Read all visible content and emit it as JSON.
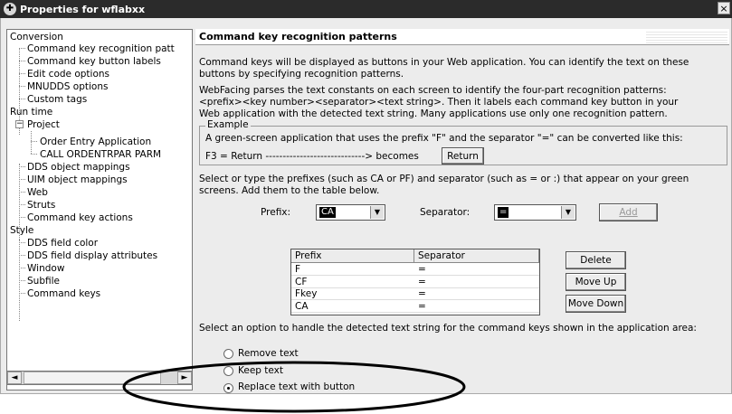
{
  "window": {
    "title": "Properties for wflabxx",
    "close": "×"
  },
  "tree": {
    "items": [
      {
        "label": "Conversion"
      },
      {
        "label": "Command key recognition patt"
      },
      {
        "label": "Command key button labels"
      },
      {
        "label": "Edit code options"
      },
      {
        "label": "MNUDDS options"
      },
      {
        "label": "Custom tags"
      },
      {
        "label": "Run time"
      },
      {
        "label": "Project"
      },
      {
        "label": "Order Entry Application"
      },
      {
        "label": "CALL ORDENTRPAR PARM"
      },
      {
        "label": "DDS object mappings"
      },
      {
        "label": "UIM object mappings"
      },
      {
        "label": "Web"
      },
      {
        "label": "Struts"
      },
      {
        "label": "Command key actions"
      },
      {
        "label": "Style"
      },
      {
        "label": "DDS field color"
      },
      {
        "label": "DDS field display attributes"
      },
      {
        "label": "Window"
      },
      {
        "label": "Subfile"
      },
      {
        "label": "Command keys"
      }
    ],
    "expander": "−",
    "scroll_left": "◄",
    "scroll_right": "►"
  },
  "panel": {
    "title": "Command key recognition patterns",
    "intro_line1": "Command keys will be displayed as buttons in your Web application.  You can identify the text on these",
    "intro_line2": "buttons by specifying recognition patterns.",
    "desc_line1": "WebFacing parses the text constants on each screen to identify the four-part recognition patterns:",
    "desc_line2": "<prefix><key number><separator><text string>.  Then it labels each command key button in your",
    "desc_line3": "Web application with the detected text string.  Many applications use only one recognition pattern.",
    "example": {
      "legend": "Example",
      "line1": "A green-screen application that uses the prefix \"F\" and the separator \"=\" can be converted like this:",
      "line2": "F3 = Return  ----------------------------->  becomes",
      "button": "Return"
    },
    "select_line1": "Select or type the prefixes (such as CA or PF) and separator (such as = or :) that appear on your green",
    "select_line2": "screens.  Add them to the table below.",
    "prefix_label": "Prefix:",
    "prefix_value": "CA",
    "separator_label": "Separator:",
    "separator_value": "=",
    "add_button": "Add",
    "table": {
      "headers": [
        "Prefix",
        "Separator"
      ],
      "rows": [
        [
          "F",
          "="
        ],
        [
          "CF",
          "="
        ],
        [
          "Fkey",
          "="
        ],
        [
          "CA",
          "="
        ]
      ]
    },
    "delete_button": "Delete",
    "moveup_button": "Move Up",
    "movedown_button": "Move Down",
    "option_text": "Select an option to handle the detected text string for the command keys shown in the application area:",
    "radio_remove": "Remove text",
    "radio_keep": "Keep text",
    "radio_replace": "Replace text with button",
    "selected_option": "Replace text with button"
  }
}
